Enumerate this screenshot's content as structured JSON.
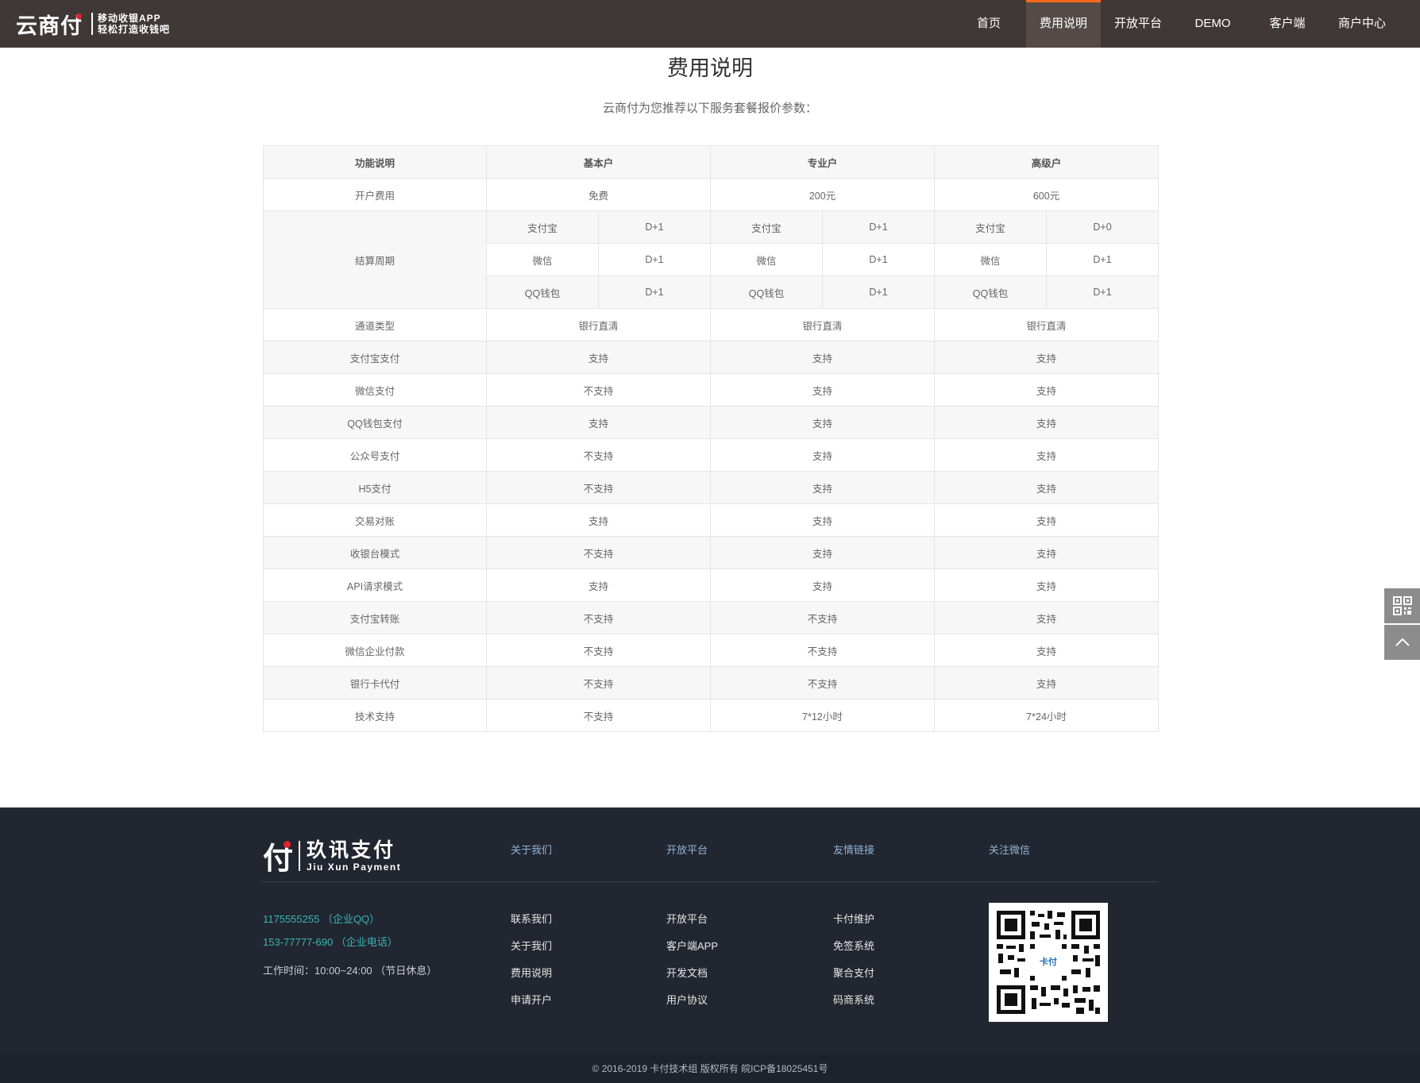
{
  "header": {
    "logo_main": "云商付",
    "logo_sub_line1": "移动收银APP",
    "logo_sub_line2": "轻松打造收钱吧",
    "nav": [
      {
        "label": "首页",
        "active": false
      },
      {
        "label": "费用说明",
        "active": true
      },
      {
        "label": "开放平台",
        "active": false
      },
      {
        "label": "DEMO",
        "active": false
      },
      {
        "label": "客户端",
        "active": false
      },
      {
        "label": "商户中心",
        "active": false
      }
    ],
    "accent_color": "#ff6a1a"
  },
  "main": {
    "title": "费用说明",
    "subtitle": "云商付为您推荐以下服务套餐报价参数：",
    "table": {
      "headers": [
        "功能说明",
        "基本户",
        "专业户",
        "高级户"
      ],
      "open_fee": {
        "label": "开户费用",
        "values": [
          "免费",
          "200元",
          "600元"
        ]
      },
      "settlement": {
        "label": "结算周期",
        "rows": [
          {
            "channel": "支付宝",
            "values": [
              "D+1",
              "D+1",
              "D+0"
            ]
          },
          {
            "channel": "微信",
            "values": [
              "D+1",
              "D+1",
              "D+1"
            ]
          },
          {
            "channel": "QQ钱包",
            "values": [
              "D+1",
              "D+1",
              "D+1"
            ]
          }
        ]
      },
      "rows": [
        {
          "label": "通道类型",
          "values": [
            "银行直清",
            "银行直清",
            "银行直清"
          ]
        },
        {
          "label": "支付宝支付",
          "values": [
            "支持",
            "支持",
            "支持"
          ]
        },
        {
          "label": "微信支付",
          "values": [
            "不支持",
            "支持",
            "支持"
          ]
        },
        {
          "label": "QQ钱包支付",
          "values": [
            "支持",
            "支持",
            "支持"
          ]
        },
        {
          "label": "公众号支付",
          "values": [
            "不支持",
            "支持",
            "支持"
          ]
        },
        {
          "label": "H5支付",
          "values": [
            "不支持",
            "支持",
            "支持"
          ]
        },
        {
          "label": "交易对账",
          "values": [
            "支持",
            "支持",
            "支持"
          ]
        },
        {
          "label": "收银台模式",
          "values": [
            "不支持",
            "支持",
            "支持"
          ]
        },
        {
          "label": "API请求模式",
          "values": [
            "支持",
            "支持",
            "支持"
          ]
        },
        {
          "label": "支付宝转账",
          "values": [
            "不支持",
            "不支持",
            "支持"
          ]
        },
        {
          "label": "微信企业付款",
          "values": [
            "不支持",
            "不支持",
            "支持"
          ]
        },
        {
          "label": "银行卡代付",
          "values": [
            "不支持",
            "不支持",
            "支持"
          ]
        },
        {
          "label": "技术支持",
          "values": [
            "不支持",
            "7*12小时",
            "7*24小时"
          ]
        }
      ]
    }
  },
  "side_tools": {
    "icons": [
      "qr-code-icon",
      "arrow-up-icon"
    ]
  },
  "footer": {
    "logo_fu": "付",
    "logo_cn": "玖讯支付",
    "logo_en": "Jiu Xun Payment",
    "columns": [
      {
        "heading": "关于我们",
        "links": [
          "联系我们",
          "关于我们",
          "费用说明",
          "申请开户"
        ]
      },
      {
        "heading": "开放平台",
        "links": [
          "开放平台",
          "客户端APP",
          "开发文档",
          "用户协议"
        ]
      },
      {
        "heading": "友情链接",
        "links": [
          "卡付维护",
          "免签系统",
          "聚合支付",
          "码商系统"
        ]
      },
      {
        "heading": "关注微信",
        "links": []
      }
    ],
    "contact": {
      "qq": "1175555255 （企业QQ）",
      "phone": "153-77777-690 （企业电话）",
      "hours": "工作时间：10:00~24:00 （节日休息）"
    },
    "qr_label": "卡付",
    "copyright": "© 2016-2019 卡付技术组 版权所有 皖ICP备18025451号",
    "link_color": "#8fb4d8",
    "contact_color": "#35b6b6"
  }
}
